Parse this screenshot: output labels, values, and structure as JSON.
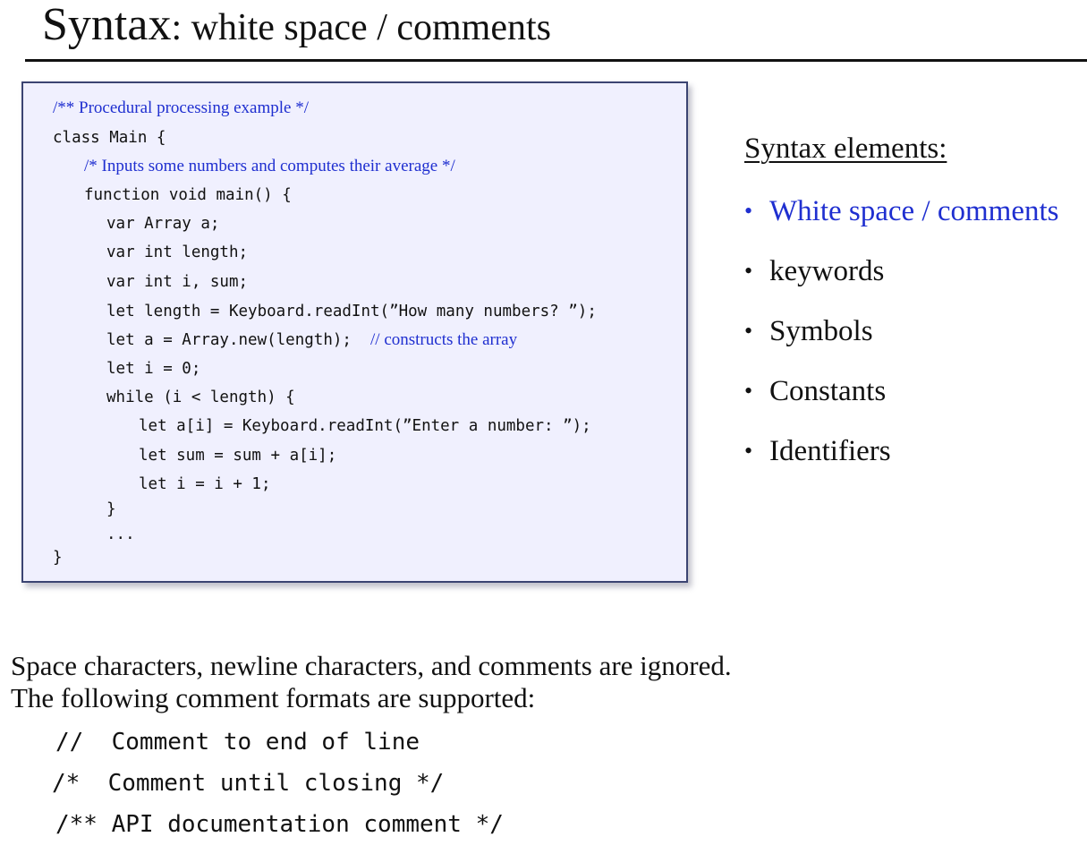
{
  "title": {
    "main": "Syntax",
    "rest": ": white space / comments"
  },
  "code": {
    "lines": [
      {
        "code": "",
        "comment": "/** Procedural processing example */"
      },
      {
        "code": "class Main {",
        "comment": ""
      },
      {
        "code": "",
        "comment": "/* Inputs some numbers and computes their average */"
      },
      {
        "code": "function void main() {",
        "comment": ""
      },
      {
        "code": "var Array a;",
        "comment": ""
      },
      {
        "code": "var int length;",
        "comment": ""
      },
      {
        "code": "var int i, sum;",
        "comment": ""
      },
      {
        "code": "let length = Keyboard.readInt(”How many numbers? ”);",
        "comment": ""
      },
      {
        "code": "let a = Array.new(length);  ",
        "comment": "// constructs the array"
      },
      {
        "code": "let i = 0;",
        "comment": ""
      },
      {
        "code": "while (i < length) {",
        "comment": ""
      },
      {
        "code": "let a[i] = Keyboard.readInt(”Enter a number: ”);",
        "comment": ""
      },
      {
        "code": "let sum = sum + a[i];",
        "comment": ""
      },
      {
        "code": "let i = i + 1;",
        "comment": ""
      },
      {
        "code": "}",
        "comment": ""
      },
      {
        "code": "...",
        "comment": ""
      },
      {
        "code": "}",
        "comment": ""
      }
    ]
  },
  "sidebar": {
    "heading": "Syntax elements:",
    "items": [
      {
        "bullet": "•",
        "label": "White space / comments",
        "active": true,
        "color": "#1f2fd0"
      },
      {
        "bullet": "•",
        "label": "keywords",
        "active": false
      },
      {
        "bullet": "•",
        "label": "Symbols",
        "active": false
      },
      {
        "bullet": "•",
        "label": "Constants",
        "active": false
      },
      {
        "bullet": "•",
        "label": "Identifiers",
        "active": false
      }
    ]
  },
  "description": {
    "line1": "Space characters, newline characters, and comments are ignored.",
    "line2": "The following comment formats are supported:"
  },
  "formats": [
    {
      "marker": "//",
      "text": "Comment to end of line"
    },
    {
      "marker": "/*",
      "text": "Comment until closing */"
    },
    {
      "marker": "/**",
      "text": "API documentation comment */"
    }
  ]
}
